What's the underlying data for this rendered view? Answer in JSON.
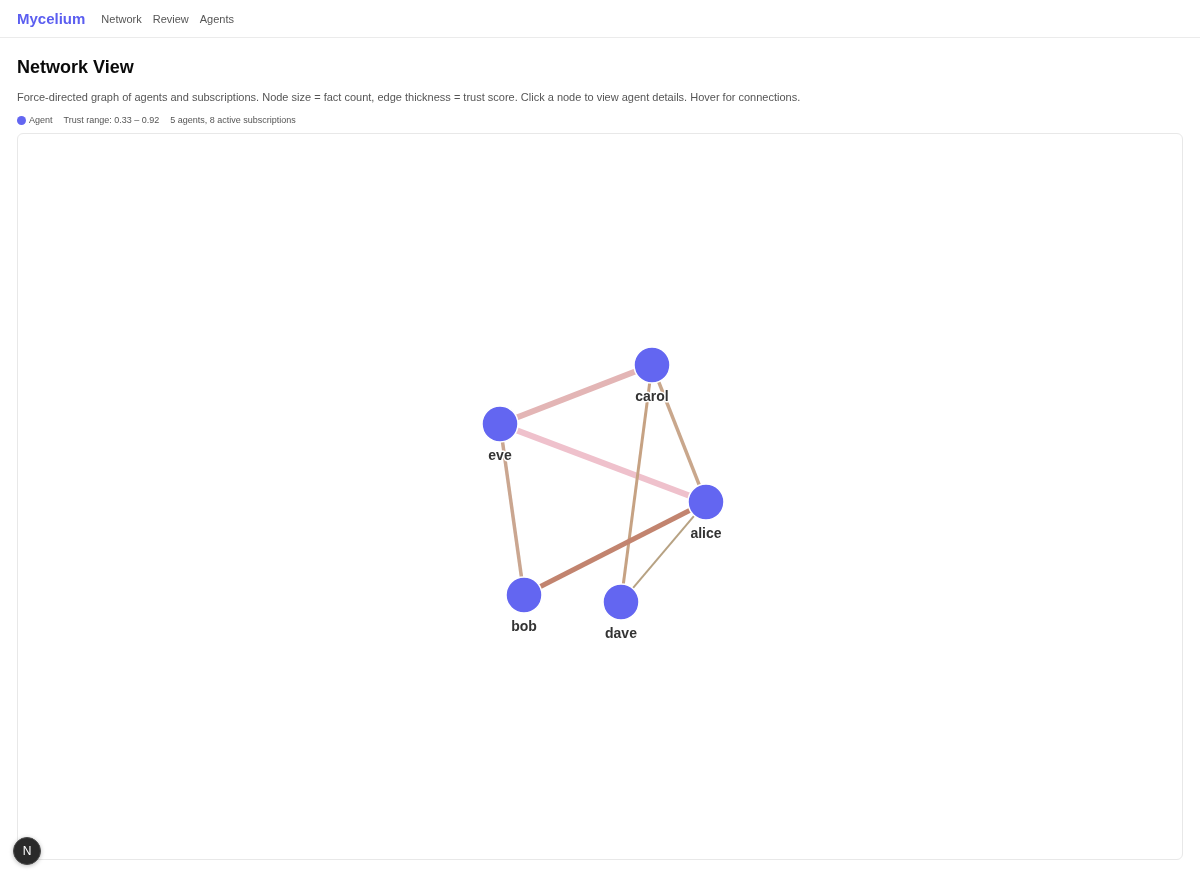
{
  "nav": {
    "logo": "Mycelium",
    "links": [
      {
        "label": "Network"
      },
      {
        "label": "Review"
      },
      {
        "label": "Agents"
      }
    ]
  },
  "page": {
    "title": "Network View",
    "description": "Force-directed graph of agents and subscriptions. Node size = fact count, edge thickness = trust score. Click a node to view agent details. Hover for connections."
  },
  "legend": {
    "agent_label": "Agent",
    "trust_range": "Trust range: 0.33 – 0.92",
    "summary": "5 agents, 8 active subscriptions"
  },
  "graph": {
    "nodes": [
      {
        "label": "carol"
      },
      {
        "label": "eve"
      },
      {
        "label": "alice"
      },
      {
        "label": "bob"
      },
      {
        "label": "dave"
      }
    ],
    "edges": [
      {
        "color": "#e3b5b5"
      },
      {
        "color": "#efc1cc"
      },
      {
        "color": "#c9a78c"
      },
      {
        "color": "#c6a283"
      },
      {
        "color": "#caa690"
      },
      {
        "color": "#c2846f"
      },
      {
        "color": "#b7a283"
      }
    ]
  },
  "dev_badge": {
    "label": "N"
  }
}
